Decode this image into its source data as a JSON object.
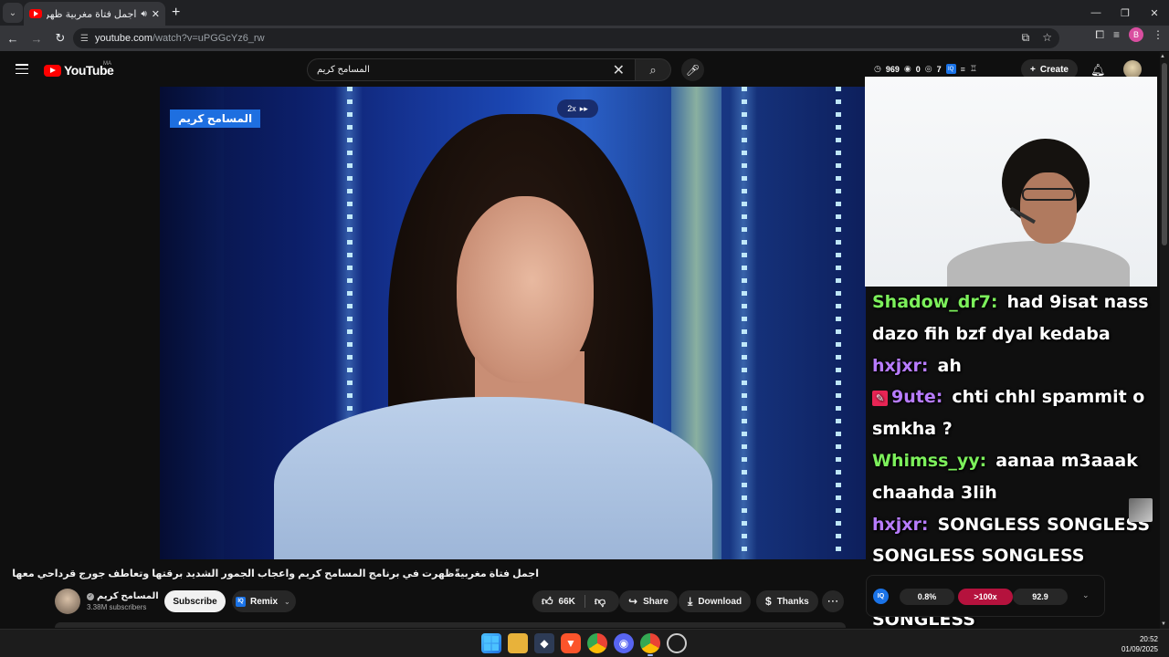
{
  "browser": {
    "tab_title": "اجمل فتاة مغربية ظهرت في",
    "url_host": "youtube.com",
    "url_path": "/watch?v=uPGGcYz6_rw",
    "profile_initial": "B"
  },
  "yt_header": {
    "logo_text": "YouTube",
    "country_code": "MA",
    "search_query": "المسامح كريم",
    "stats": {
      "views": "969",
      "zero": "0",
      "watch": "7"
    },
    "create_label": "Create"
  },
  "video": {
    "channel_overlay": "المسامح كريم",
    "speed_label": "2x"
  },
  "chat": {
    "colors": {
      "green": "#7cf05b",
      "purple": "#b87cff",
      "white": "#ffffff"
    },
    "messages": [
      {
        "name": "Shadow_dr7:",
        "text": "had 9isat nass dazo fih bzf dyal kedaba",
        "color": "#7cf05b",
        "badge": ""
      },
      {
        "name": "hxjxr:",
        "text": "ah",
        "color": "#b87cff",
        "badge": ""
      },
      {
        "name": "9ute:",
        "text": "chti chhl spammit o smkha ?",
        "color": "#b87cff",
        "badge": "pin"
      },
      {
        "name": "Whimss_yy:",
        "text": "aanaa m3aaak chaahda 3lih",
        "color": "#7cf05b",
        "badge": ""
      },
      {
        "name": "hxjxr:",
        "text": "SONGLESS SONGLESS SONGLESS SONGLESS SONGLESS SONGLESS SONGLESS",
        "color": "#b87cff",
        "badge": ""
      }
    ]
  },
  "watch": {
    "title": "اجمل فتاة مغربيةّ‏ظهرت في برنامج المسامح كريم واعجاب الجمور الشديد برقتها وتعاطف جورج قرداحي معها",
    "channel_name": "المسامح كريم",
    "subscribers": "3.38M subscribers",
    "subscribe_label": "Subscribe",
    "remix_label": "Remix",
    "likes": "66K",
    "share_label": "Share",
    "download_label": "Download",
    "thanks_label": "Thanks"
  },
  "iq_panel": {
    "logo": "IQ",
    "values": [
      "0.8%",
      ">100x",
      "92.9"
    ]
  },
  "taskbar": {
    "time": "20:52",
    "date": "01/09/2025"
  }
}
